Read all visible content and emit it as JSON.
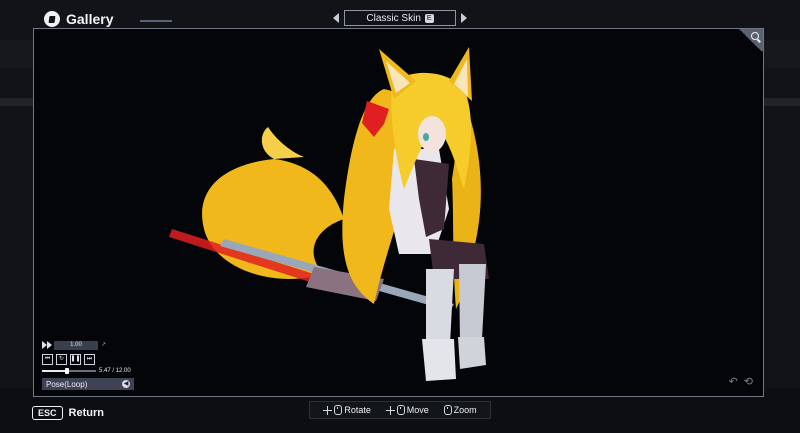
{
  "header": {
    "title": "Gallery"
  },
  "skin": {
    "label": "Classic Skin",
    "key": "E"
  },
  "animation": {
    "speed": "1.00",
    "current_time": "5.47",
    "total_time": "12.00",
    "time_text": "5.47 / 12.00",
    "progress": 0.456,
    "pose": "Pose(Loop)"
  },
  "footer": {
    "esc_key": "ESC",
    "return_label": "Return",
    "hints": [
      {
        "label": "Rotate"
      },
      {
        "label": "Move"
      },
      {
        "label": "Zoom"
      }
    ]
  },
  "colors": {
    "background": "#121316",
    "viewer_bg": "#030509",
    "hair": "#f0b81a",
    "accent_red": "#e02020"
  }
}
